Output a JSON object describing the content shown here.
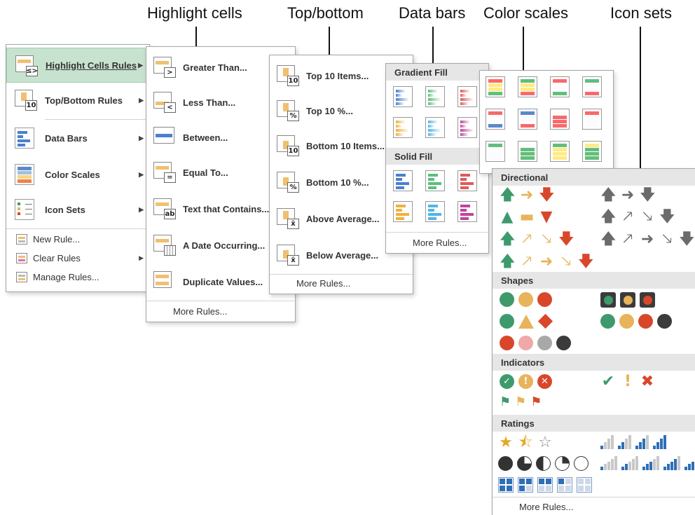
{
  "callouts": [
    "Highlight cells",
    "Top/bottom",
    "Data bars",
    "Color scales",
    "Icon sets"
  ],
  "main_menu": {
    "items": [
      {
        "label": "Highlight Cells Rules",
        "icon": "highlight-cells-icon"
      },
      {
        "label": "Top/Bottom Rules",
        "icon": "top-bottom-icon"
      },
      {
        "label": "Data Bars",
        "icon": "data-bars-icon"
      },
      {
        "label": "Color Scales",
        "icon": "color-scales-icon"
      },
      {
        "label": "Icon Sets",
        "icon": "icon-sets-icon"
      }
    ],
    "small_items": [
      {
        "label": "New Rule...",
        "icon": "new-rule-icon"
      },
      {
        "label": "Clear Rules",
        "icon": "clear-rules-icon"
      },
      {
        "label": "Manage Rules...",
        "icon": "manage-rules-icon"
      }
    ]
  },
  "highlight_menu": {
    "items": [
      {
        "label": "Greater Than...",
        "badge": ">"
      },
      {
        "label": "Less Than...",
        "badge": "<"
      },
      {
        "label": "Between...",
        "badge": ""
      },
      {
        "label": "Equal To...",
        "badge": "="
      },
      {
        "label": "Text that Contains...",
        "badge": "ab"
      },
      {
        "label": "A Date Occurring...",
        "badge": "cal"
      },
      {
        "label": "Duplicate Values...",
        "badge": ""
      }
    ],
    "more": "More Rules..."
  },
  "topbottom_menu": {
    "items": [
      {
        "label": "Top 10 Items...",
        "badge": "10"
      },
      {
        "label": "Top 10 %...",
        "badge": "%"
      },
      {
        "label": "Bottom 10 Items...",
        "badge": "10"
      },
      {
        "label": "Bottom 10 %...",
        "badge": "%"
      },
      {
        "label": "Above Average...",
        "badge": "x̄"
      },
      {
        "label": "Below Average...",
        "badge": "x̄"
      }
    ],
    "more": "More Rules..."
  },
  "databars_menu": {
    "gradient_header": "Gradient Fill",
    "solid_header": "Solid Fill",
    "colors": [
      "#4a7fd0",
      "#5cbf7a",
      "#e05a5a",
      "#f0b040",
      "#52b5e6",
      "#c0449c"
    ],
    "more": "More Rules..."
  },
  "colorscales_menu": {
    "scales": [
      [
        "#f8696b",
        "#ffeb84",
        "#63be7b"
      ],
      [
        "#63be7b",
        "#ffeb84",
        "#f8696b"
      ],
      [
        "#f8696b",
        "#fcfcff",
        "#63be7b"
      ],
      [
        "#63be7b",
        "#fcfcff",
        "#f8696b"
      ],
      [
        "#f8696b",
        "#fcfcff",
        "#5a8ac6"
      ],
      [
        "#5a8ac6",
        "#fcfcff",
        "#f8696b"
      ],
      [
        "#fcfcff",
        "#f8696b",
        "#f8696b"
      ],
      [
        "#f8696b",
        "#fcfcff",
        "#fcfcff"
      ],
      [
        "#63be7b",
        "#fcfcff",
        "#fcfcff"
      ],
      [
        "#fcfcff",
        "#63be7b",
        "#63be7b"
      ],
      [
        "#63be7b",
        "#ffeb84",
        "#ffeb84"
      ],
      [
        "#ffeb84",
        "#63be7b",
        "#63be7b"
      ]
    ]
  },
  "iconsets_menu": {
    "directional_header": "Directional",
    "shapes_header": "Shapes",
    "indicators_header": "Indicators",
    "ratings_header": "Ratings",
    "more": "More Rules..."
  },
  "colors": {
    "green": "#3e9a6c",
    "amber": "#e8b35a",
    "red": "#d9472b",
    "gray": "#6b6b6b",
    "highlight": "#c7e3cf"
  }
}
